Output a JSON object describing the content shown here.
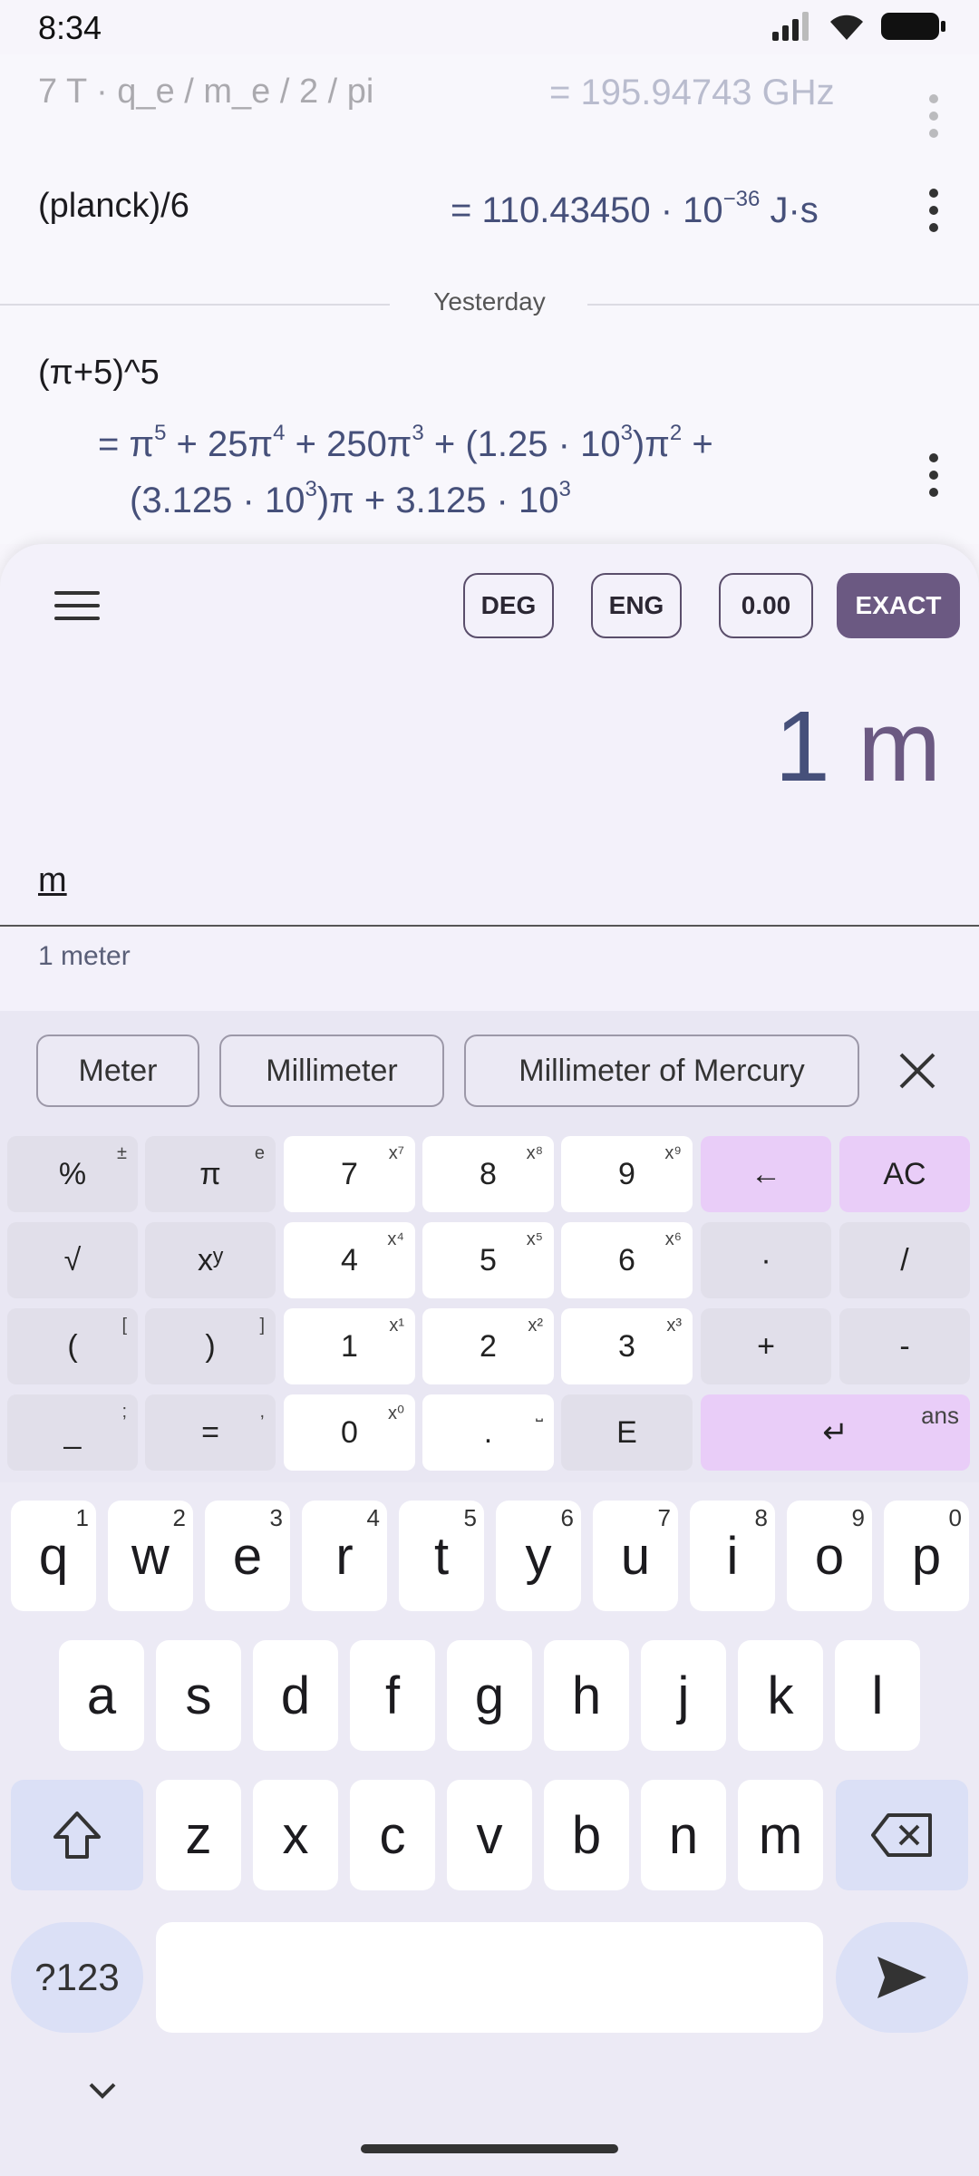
{
  "status": {
    "time": "8:34"
  },
  "history": {
    "row0": {
      "expr": "7 T · q_e / m_e / 2 / pi",
      "result": "= 195.94743 GHz"
    },
    "row1": {
      "expr": "(planck)/6",
      "result_prefix": "= 110.43450 · 10",
      "result_exp": "−36",
      "result_unit": " J·s"
    },
    "divider_label": "Yesterday",
    "row2": {
      "expr": "(π+5)^5",
      "line1": "= π5 + 25π4 + 250π3 + (1.25 · 103)π2 +",
      "line2": "(3.125 · 103)π + 3.125 · 103"
    }
  },
  "modes": {
    "deg": "DEG",
    "eng": "ENG",
    "precision": "0.00",
    "exact": "EXACT"
  },
  "display": {
    "value": "1",
    "unit": "m",
    "input": "m",
    "hint": "1 meter"
  },
  "suggestions": [
    "Meter",
    "Millimeter",
    "Millimeter of Mercury"
  ],
  "keypad": {
    "percent": "%",
    "plusminus": "±",
    "pi": "π",
    "e": "e",
    "seven": "7",
    "eight": "8",
    "nine": "9",
    "back": "←",
    "ac": "AC",
    "sqrt": "√",
    "pow": "xʸ",
    "four": "4",
    "five": "5",
    "six": "6",
    "mul": "·",
    "div": "/",
    "lparen": "(",
    "lbracket": "[",
    "rparen": ")",
    "rbracket": "]",
    "one": "1",
    "two": "2",
    "three": "3",
    "plus": "+",
    "minus": "-",
    "underscore": "_",
    "semicolon": ";",
    "equals": "=",
    "comma": ",",
    "zero": "0",
    "dot": ".",
    "space_hint": "⎵",
    "exp": "E",
    "enter": "↵",
    "ans": "ans",
    "x7": "x⁷",
    "x8": "x⁸",
    "x9": "x⁹",
    "x4": "x⁴",
    "x5": "x⁵",
    "x6": "x⁶",
    "x1": "x¹",
    "x2": "x²",
    "x3": "x³",
    "x0": "x⁰"
  },
  "keyboard": {
    "row1": [
      "q",
      "w",
      "e",
      "r",
      "t",
      "y",
      "u",
      "i",
      "o",
      "p"
    ],
    "row1_hints": [
      "1",
      "2",
      "3",
      "4",
      "5",
      "6",
      "7",
      "8",
      "9",
      "0"
    ],
    "row2": [
      "a",
      "s",
      "d",
      "f",
      "g",
      "h",
      "j",
      "k",
      "l"
    ],
    "row3": [
      "z",
      "x",
      "c",
      "v",
      "b",
      "n",
      "m"
    ],
    "symbols": "?123"
  }
}
